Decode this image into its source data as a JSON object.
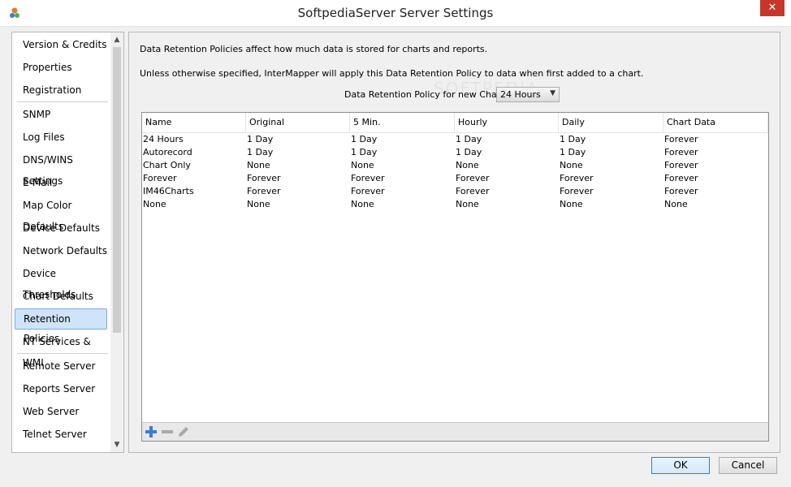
{
  "window": {
    "title": "SoftpediaServer Server Settings",
    "close_glyph": "✕"
  },
  "sidebar": {
    "items": [
      {
        "label": "Version & Credits",
        "name": "sidebar-item-version-credits"
      },
      {
        "label": "Properties",
        "name": "sidebar-item-properties"
      },
      {
        "label": "Registration",
        "name": "sidebar-item-registration"
      },
      {
        "label": "SNMP",
        "name": "sidebar-item-snmp"
      },
      {
        "label": "Log Files",
        "name": "sidebar-item-log-files"
      },
      {
        "label": "DNS/WINS Settings",
        "name": "sidebar-item-dns-wins"
      },
      {
        "label": "E-Mail",
        "name": "sidebar-item-email"
      },
      {
        "label": "Map Color Defaults",
        "name": "sidebar-item-map-color-defaults"
      },
      {
        "label": "Device Defaults",
        "name": "sidebar-item-device-defaults"
      },
      {
        "label": "Network Defaults",
        "name": "sidebar-item-network-defaults"
      },
      {
        "label": "Device Thresholds",
        "name": "sidebar-item-device-thresholds"
      },
      {
        "label": "Chart Defaults",
        "name": "sidebar-item-chart-defaults"
      },
      {
        "label": "Retention Policies",
        "name": "sidebar-item-retention-policies",
        "selected": true
      },
      {
        "label": "NT Services & WMI",
        "name": "sidebar-item-nt-services-wmi"
      },
      {
        "label": "Remote Server",
        "name": "sidebar-item-remote-server"
      },
      {
        "label": "Reports Server",
        "name": "sidebar-item-reports-server"
      },
      {
        "label": "Web Server",
        "name": "sidebar-item-web-server"
      },
      {
        "label": "Telnet Server",
        "name": "sidebar-item-telnet-server"
      }
    ]
  },
  "panel": {
    "intro": "Data Retention Policies affect how much data is stored for charts and reports.",
    "note": "Unless otherwise specified, InterMapper will apply this Data Retention Policy to data when first added to a chart.",
    "policy_label": "Data Retention Policy for new Charts:",
    "policy_value": "24 Hours"
  },
  "table": {
    "columns": [
      "Name",
      "Original",
      "5 Min.",
      "Hourly",
      "Daily",
      "Chart Data"
    ],
    "rows": [
      [
        "24 Hours",
        "1 Day",
        "1 Day",
        "1 Day",
        "1 Day",
        "Forever"
      ],
      [
        "Autorecord",
        "1 Day",
        "1 Day",
        "1 Day",
        "1 Day",
        "Forever"
      ],
      [
        "Chart Only",
        "None",
        "None",
        "None",
        "None",
        "Forever"
      ],
      [
        "Forever",
        "Forever",
        "Forever",
        "Forever",
        "Forever",
        "Forever"
      ],
      [
        "IM46Charts",
        "Forever",
        "Forever",
        "Forever",
        "Forever",
        "Forever"
      ],
      [
        "None",
        "None",
        "None",
        "None",
        "None",
        "None"
      ]
    ],
    "toolbar": {
      "add_icon": "plus-icon",
      "remove_icon": "minus-icon",
      "edit_icon": "pencil-icon"
    }
  },
  "buttons": {
    "ok": "OK",
    "cancel": "Cancel"
  },
  "colors": {
    "selected_bg": "#cfe4fa",
    "close_bg": "#c7352b",
    "add_icon": "#3a7bd5"
  }
}
